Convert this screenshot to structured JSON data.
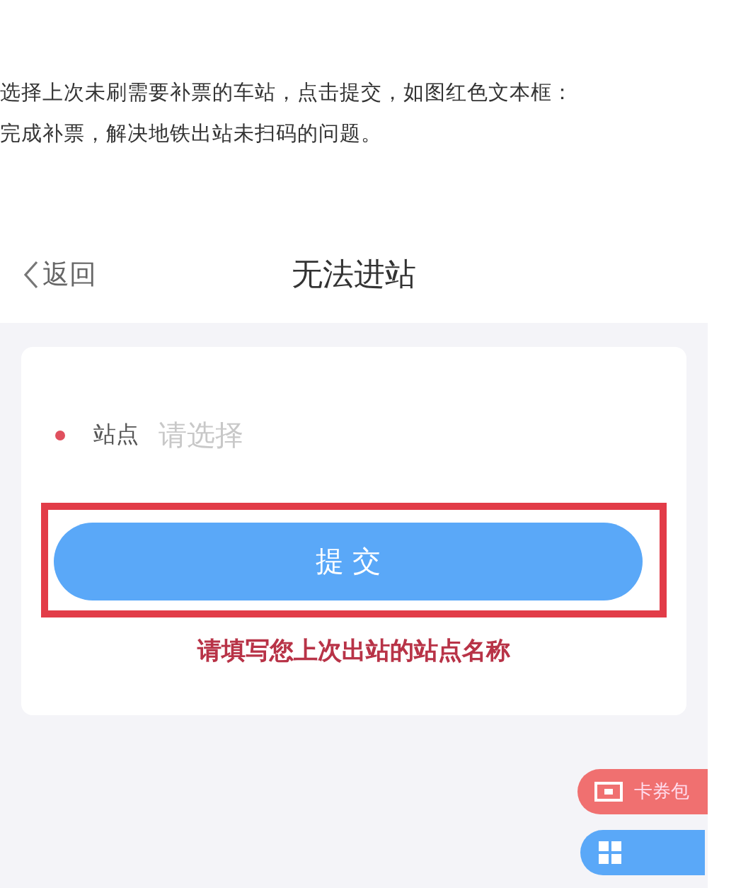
{
  "article": {
    "lines": [
      "选择上次未刷需要补票的车站，点击提交，如图红色文本框：",
      "完成补票，解决地铁出站未扫码的问题。"
    ]
  },
  "app": {
    "nav": {
      "back": "返回",
      "title": "无法进站"
    },
    "form": {
      "field": {
        "label": "站点",
        "placeholder": "请选择",
        "required": true
      },
      "submit": "提 交",
      "hint": "请填写您上次出站的站点名称"
    },
    "floating": {
      "coupon": "卡券包"
    }
  }
}
